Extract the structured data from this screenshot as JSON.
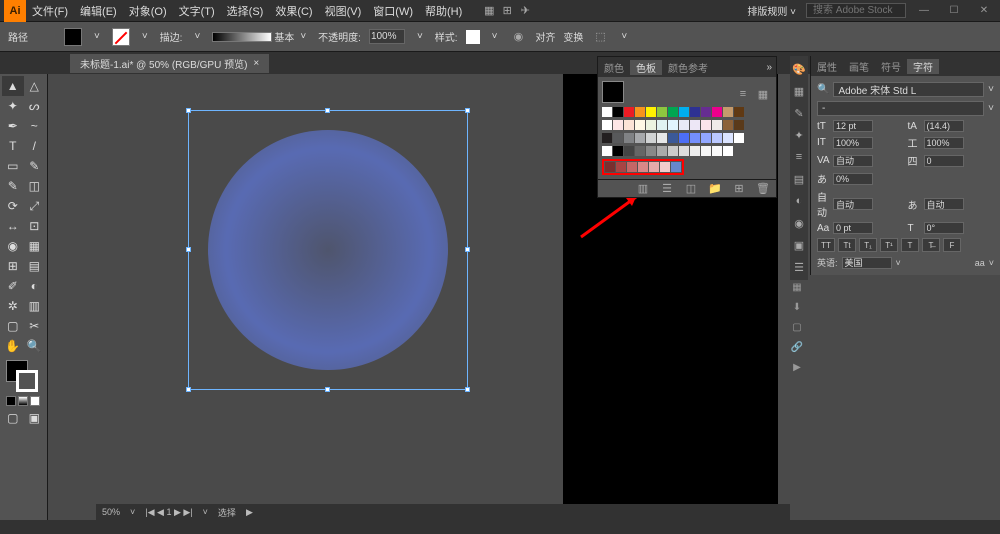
{
  "app": {
    "name": "Ai"
  },
  "menubar": {
    "items": [
      "文件(F)",
      "编辑(E)",
      "对象(O)",
      "文字(T)",
      "选择(S)",
      "效果(C)",
      "视图(V)",
      "窗口(W)",
      "帮助(H)"
    ],
    "workspace": "排版规则",
    "search_placeholder": "搜索 Adobe Stock"
  },
  "controlbar": {
    "label": "路径",
    "stroke_label": "描边:",
    "style_value": "基本",
    "opacity_label": "不透明度:",
    "opacity_value": "100%",
    "style_label": "样式:",
    "align_label": "对齐",
    "transform_label": "变换"
  },
  "document": {
    "tab_title": "未标题-1.ai* @ 50% (RGB/GPU 预览)",
    "close": "×"
  },
  "swatches": {
    "tabs": [
      "颜色",
      "色板",
      "颜色参考"
    ],
    "active_tab": 1,
    "row1": [
      "#ffffff",
      "#000000",
      "#ed1c24",
      "#f7941d",
      "#fff200",
      "#8dc63f",
      "#00a651",
      "#00aeef",
      "#2e3192",
      "#662d91",
      "#ec008c",
      "#c49a6c",
      "#603913"
    ],
    "row2": [
      "#ffffff",
      "#fde6e6",
      "#fce4d6",
      "#fff9e6",
      "#ecf4e0",
      "#e0f2f1",
      "#e1f5fe",
      "#e8eaf6",
      "#ede7f6",
      "#fce4ec",
      "#efebe9",
      "#8c6239",
      "#5a3a1a"
    ],
    "row3": [
      "#231f20",
      "#58595b",
      "#808285",
      "#a7a9ac",
      "#d1d3d4",
      "#e6e7e8",
      "#3b5998",
      "#4c6ef5",
      "#748ffc",
      "#91a7ff",
      "#bac8ff",
      "#dbe4ff",
      "#ffffff"
    ],
    "row4": [
      "#ffffff",
      "#000000",
      "#444",
      "#666",
      "#888",
      "#aaa",
      "#ccc",
      "#ddd",
      "#eee",
      "#f5f5f5",
      "#fafafa",
      "#ffffff"
    ],
    "highlight_row": [
      "#7a2e2e",
      "#a84444",
      "#c46666",
      "#d98888",
      "#e6aaaa",
      "#f2cccc",
      "#6688cc"
    ]
  },
  "char_panel": {
    "tabs": [
      "属性",
      "画笔",
      "符号",
      "字符"
    ],
    "active_tab": 3,
    "font_family": "Adobe 宋体 Std L",
    "font_style": "-",
    "size_label": "tT",
    "size_value": "12 pt",
    "leading_label": "tA",
    "leading_value": "(14.4)",
    "vscale_label": "IT",
    "vscale_value": "100%",
    "hscale_label": "工",
    "hscale_value": "100%",
    "kern_label": "VA",
    "kern_value": "自动",
    "track_label": "四",
    "track_value": "0",
    "baseline_label": "あ",
    "baseline_value": "0%",
    "tsume_label": "あ",
    "tsume_value": "自动",
    "auto_label": "自动",
    "auto_value": "自动",
    "shift_label": "Aa",
    "shift_value": "0 pt",
    "rotate_label": "T",
    "rotate_value": "0°",
    "tt_buttons": [
      "TT",
      "Tt",
      "T₁",
      "T¹",
      "T",
      "T̶",
      "F"
    ],
    "lang_label": "英语:",
    "lang_value": "美国",
    "aa_value": "aa"
  },
  "statusbar": {
    "zoom": "50%",
    "nav": "|◀ ◀ 1 ▶ ▶|",
    "info": "选择",
    "play": "▶"
  },
  "chart_data": null
}
